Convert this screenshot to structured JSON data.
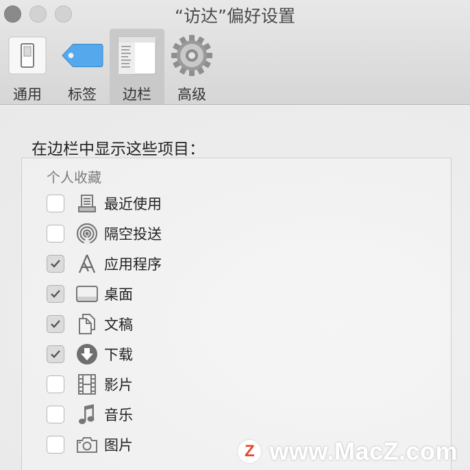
{
  "window": {
    "title": "“访达”偏好设置"
  },
  "toolbar": {
    "items": [
      {
        "label": "通用",
        "icon": "general-switch-icon",
        "selected": false
      },
      {
        "label": "标签",
        "icon": "tag-icon",
        "selected": false
      },
      {
        "label": "边栏",
        "icon": "sidebar-icon",
        "selected": true
      },
      {
        "label": "高级",
        "icon": "gear-icon",
        "selected": false
      }
    ]
  },
  "content": {
    "heading": "在边栏中显示这些项目：",
    "section": "个人收藏",
    "items": [
      {
        "label": "最近使用",
        "icon": "recents-icon",
        "checked": false
      },
      {
        "label": "隔空投送",
        "icon": "airdrop-icon",
        "checked": false
      },
      {
        "label": "应用程序",
        "icon": "applications-icon",
        "checked": true
      },
      {
        "label": "桌面",
        "icon": "desktop-icon",
        "checked": true
      },
      {
        "label": "文稿",
        "icon": "documents-icon",
        "checked": true
      },
      {
        "label": "下载",
        "icon": "downloads-icon",
        "checked": true
      },
      {
        "label": "影片",
        "icon": "movies-icon",
        "checked": false
      },
      {
        "label": "音乐",
        "icon": "music-icon",
        "checked": false
      },
      {
        "label": "图片",
        "icon": "pictures-icon",
        "checked": false
      }
    ]
  },
  "watermark": {
    "text": "www.MacZ.com",
    "logo_letter": "Z",
    "logo_color": "#e8462b"
  }
}
